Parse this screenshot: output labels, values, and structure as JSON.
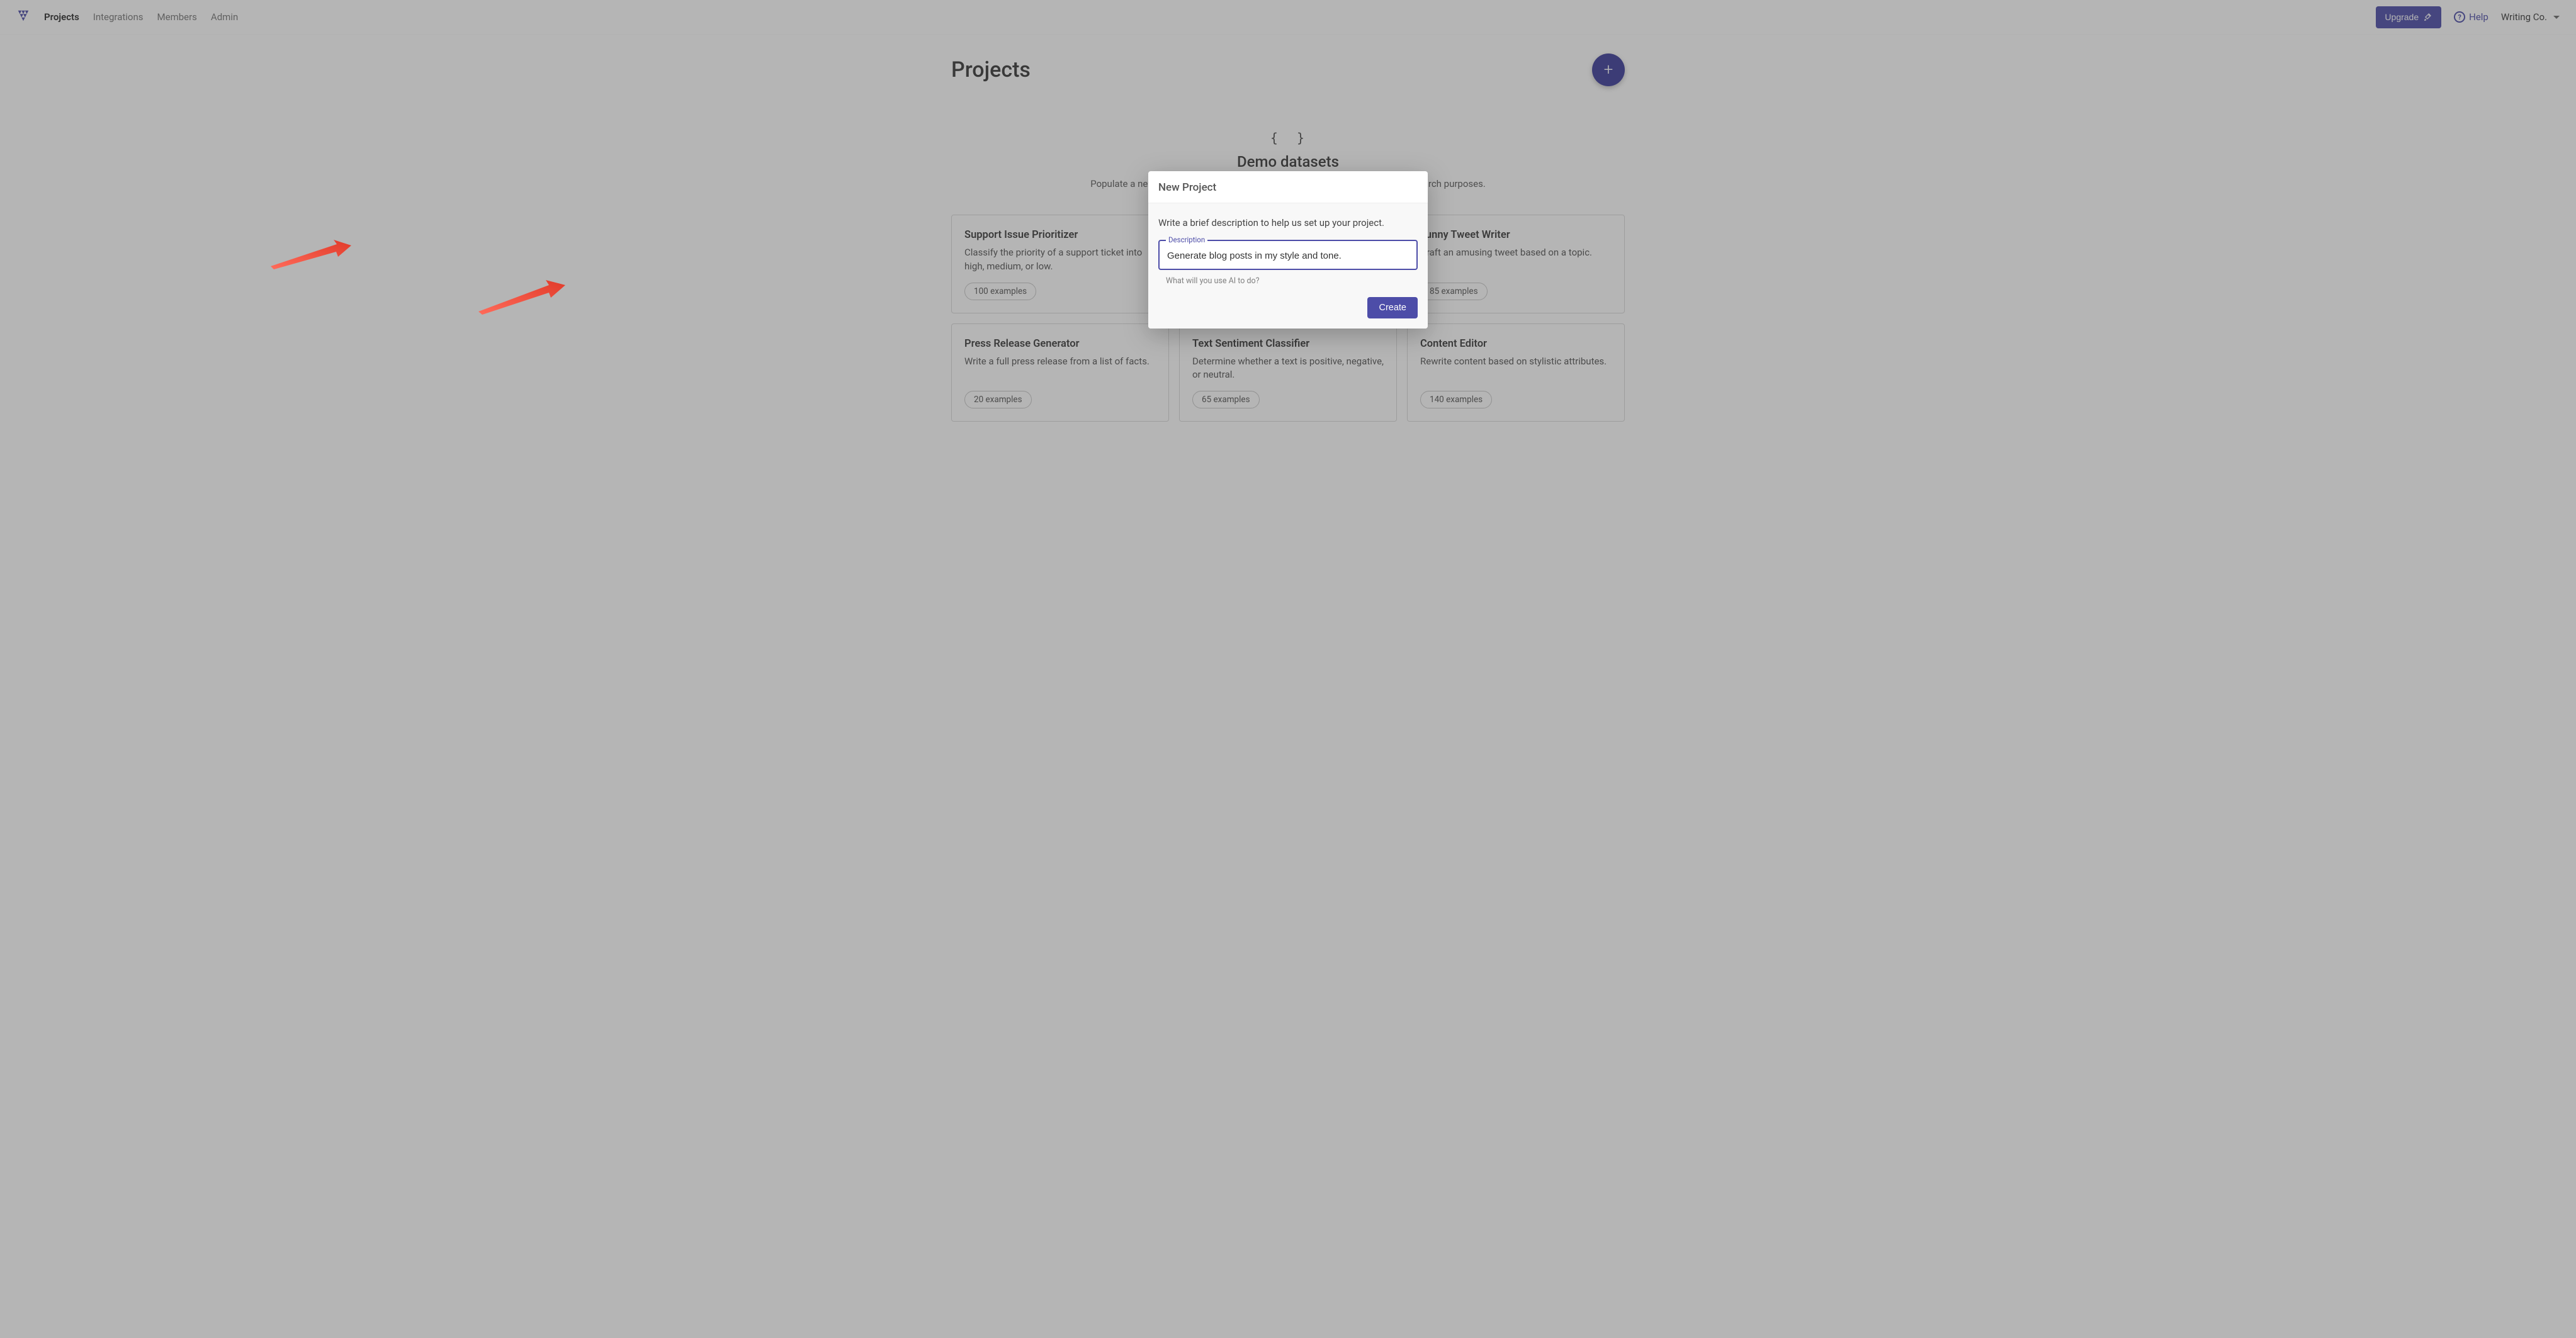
{
  "nav": {
    "links": [
      "Projects",
      "Integrations",
      "Members",
      "Admin"
    ],
    "active_index": 0,
    "upgrade_label": "Upgrade",
    "help_label": "Help",
    "org_name": "Writing Co."
  },
  "page": {
    "title": "Projects",
    "demo_section": {
      "title": "Demo datasets",
      "subtitle": "Populate a new project with a demo dataset for walkthrough and learning / research purposes."
    }
  },
  "cards": [
    {
      "title": "Support Issue Prioritizer",
      "desc": "Classify the priority of a support ticket into high, medium, or low.",
      "badge": "100 examples"
    },
    {
      "title": "Funny Tweet Writer",
      "desc": "Draft an amusing tweet based on a topic.",
      "badge": "85 examples"
    },
    {
      "title": "Press Release Generator",
      "desc": "Write a full press release from a list of facts.",
      "badge": "20 examples"
    },
    {
      "title": "Text Sentiment Classifier",
      "desc": "Determine whether a text is positive, negative, or neutral.",
      "badge": "65 examples"
    },
    {
      "title": "Content Editor",
      "desc": "Rewrite content based on stylistic attributes.",
      "badge": "140 examples"
    }
  ],
  "modal": {
    "title": "New Project",
    "instruction": "Write a brief description to help us set up your project.",
    "field_label": "Description",
    "field_value": "Generate blog posts in my style and tone.",
    "helper": "What will you use AI to do?",
    "create_label": "Create"
  }
}
